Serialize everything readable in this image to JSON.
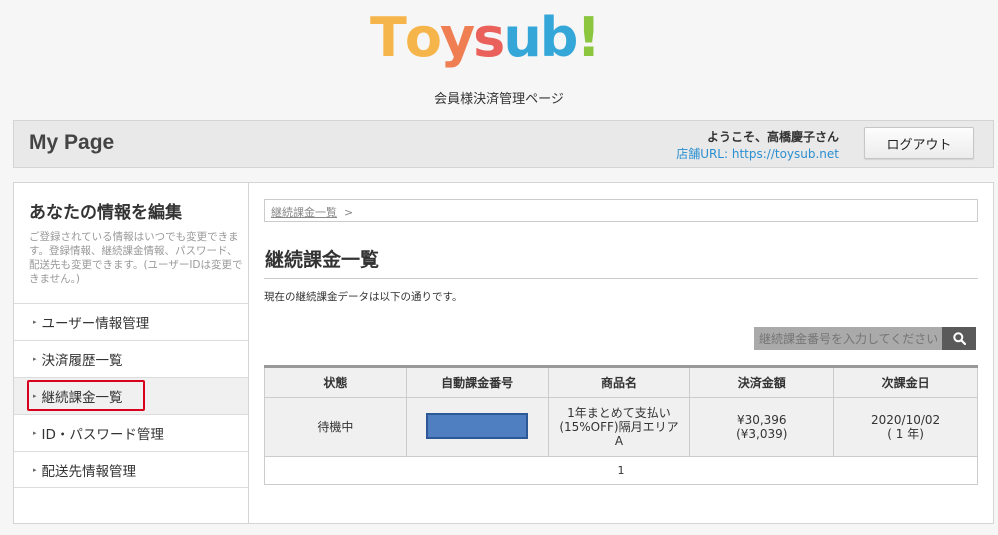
{
  "logo": {
    "letters": [
      {
        "ch": "T",
        "color": "#f5b54a"
      },
      {
        "ch": "o",
        "color": "#f5b54a"
      },
      {
        "ch": "y",
        "color": "#ef7f52"
      },
      {
        "ch": "s",
        "color": "#e9615a"
      },
      {
        "ch": "u",
        "color": "#34a7d8"
      },
      {
        "ch": "b",
        "color": "#34a7d8"
      },
      {
        "ch": "!",
        "color": "#8cc63f"
      }
    ]
  },
  "subtitle": "会員様決済管理ページ",
  "header": {
    "title": "My Page",
    "welcome": "ようこそ、高橋慶子さん",
    "store_url": "店舗URL: https://toysub.net",
    "logout_label": "ログアウト"
  },
  "sidebar": {
    "heading": "あなたの情報を編集",
    "description": "ご登録されている情報はいつでも変更できます。登録情報、継続課金情報、パスワード、配送先も変更できます。(ユーザーIDは変更できません。)",
    "items": [
      {
        "label": "ユーザー情報管理"
      },
      {
        "label": "決済履歴一覧"
      },
      {
        "label": "継続課金一覧"
      },
      {
        "label": "ID・パスワード管理"
      },
      {
        "label": "配送先情報管理"
      }
    ],
    "bullet": "▸"
  },
  "content": {
    "breadcrumb": {
      "link": "継続課金一覧",
      "sep": ">"
    },
    "title": "継続課金一覧",
    "description": "現在の継続課金データは以下の通りです。",
    "search_placeholder": "継続課金番号を入力してください",
    "table": {
      "headers": [
        "状態",
        "自動課金番号",
        "商品名",
        "決済金額",
        "次課金日"
      ],
      "row": {
        "status": "待機中",
        "product_line1": "1年まとめて支払い",
        "product_line2": "(15%OFF)隔月エリア",
        "product_line3": "A",
        "amount_line1": "¥30,396",
        "amount_line2": "(¥3,039)",
        "next_date_line1": "2020/10/02",
        "next_date_line2": "( 1 年)"
      },
      "pager": "1"
    }
  }
}
